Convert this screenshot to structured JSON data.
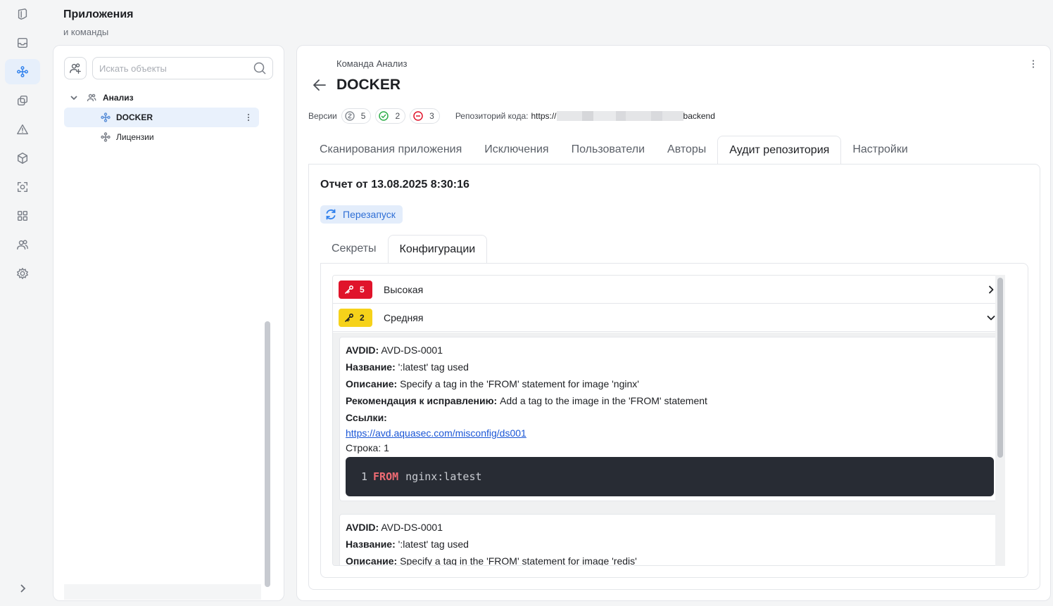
{
  "header": {
    "title": "Приложения",
    "subtitle": "и команды"
  },
  "rail": {
    "items": [
      {
        "icon": "shield-icon"
      },
      {
        "icon": "inbox-icon"
      },
      {
        "icon": "apps-icon",
        "active": true
      },
      {
        "icon": "copy-icon"
      },
      {
        "icon": "warning-icon"
      },
      {
        "icon": "cube-icon"
      },
      {
        "icon": "scan-icon"
      },
      {
        "icon": "grid-icon"
      },
      {
        "icon": "users-icon"
      },
      {
        "icon": "gear-icon"
      }
    ],
    "expand_icon": "chevron-right-icon"
  },
  "tree": {
    "search_placeholder": "Искать объекты",
    "group": {
      "label": "Анализ"
    },
    "items": [
      {
        "label": "DOCKER",
        "selected": true
      },
      {
        "label": "Лицензии",
        "selected": false
      }
    ]
  },
  "app": {
    "breadcrumb": "Команда Анализ",
    "title": "DOCKER",
    "versions_label": "Версии",
    "versions": [
      {
        "icon": "total-icon",
        "count": "5",
        "color": "#8a8f96"
      },
      {
        "icon": "check-circle-icon",
        "count": "2",
        "color": "#2fae4a"
      },
      {
        "icon": "minus-circle-icon",
        "count": "3",
        "color": "#e0142b"
      }
    ],
    "repo_label": "Репозиторий кода:",
    "repo_url_start": "https://",
    "repo_url_end": "backend"
  },
  "tabs": [
    {
      "label": "Сканирования приложения"
    },
    {
      "label": "Исключения"
    },
    {
      "label": "Пользователи"
    },
    {
      "label": "Авторы"
    },
    {
      "label": "Аудит репозитория",
      "active": true
    },
    {
      "label": "Настройки"
    }
  ],
  "report": {
    "title": "Отчет от 13.08.2025 8:30:16",
    "restart_label": "Перезапуск"
  },
  "subtabs": [
    {
      "label": "Секреты"
    },
    {
      "label": "Конфигурации",
      "active": true
    }
  ],
  "severities": [
    {
      "count": "5",
      "label": "Высокая",
      "color": "#e0142b",
      "expanded": false
    },
    {
      "count": "2",
      "label": "Средняя",
      "color": "#f6d21a",
      "expanded": true
    }
  ],
  "findings": [
    {
      "avdid_label": "AVDID:",
      "avdid": "AVD-DS-0001",
      "name_label": "Название:",
      "name": "':latest' tag used",
      "desc_label": "Описание:",
      "desc": "Specify a tag in the 'FROM' statement for image 'nginx'",
      "fix_label": "Рекомендация к исправлению:",
      "fix": "Add a tag to the image in the 'FROM' statement",
      "links_label": "Ссылки:",
      "link": "https://avd.aquasec.com/misconfig/ds001",
      "line_label": "Строка:",
      "line": "1",
      "code": {
        "line_no": "1",
        "keyword": "FROM",
        "rest": "nginx:latest"
      }
    },
    {
      "avdid_label": "AVDID:",
      "avdid": "AVD-DS-0001",
      "name_label": "Название:",
      "name": "':latest' tag used",
      "desc_label": "Описание:",
      "desc": "Specify a tag in the 'FROM' statement for image 'redis'"
    }
  ]
}
